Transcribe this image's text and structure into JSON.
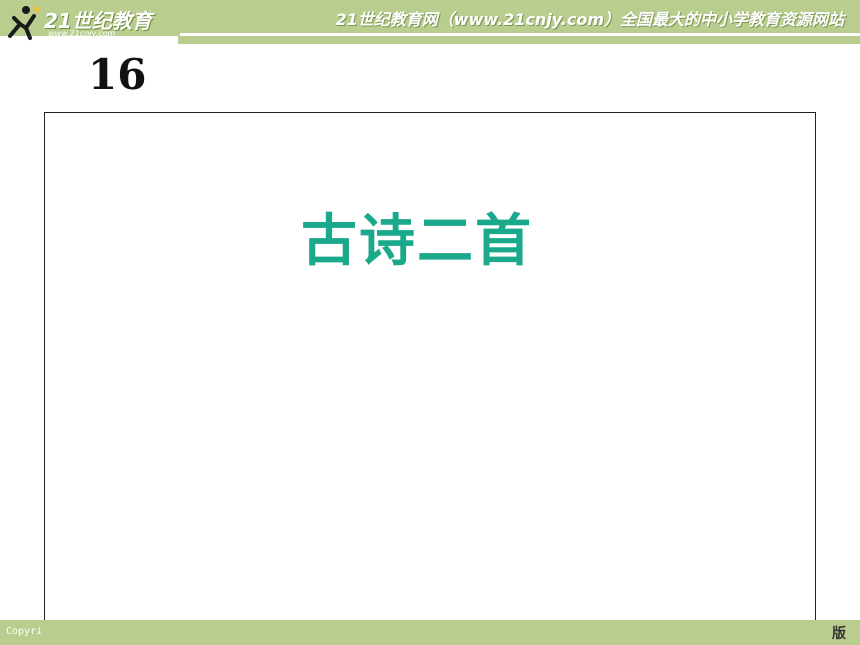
{
  "header": {
    "logo_text": "21世纪教育",
    "logo_url_text": "www.21cnjy.com",
    "slogan": "21世纪教育网（www.21cnjy.com）全国最大的中小学教育资源网站",
    "logo_icon": "running-figure-logo-icon"
  },
  "slide": {
    "lesson_number": "16",
    "title": "古诗二首"
  },
  "footer": {
    "left_text": "Copyri",
    "right_text": "版"
  },
  "colors": {
    "banner": "#b9cd8f",
    "title": "#1aa98a",
    "frame_border": "#222222"
  }
}
